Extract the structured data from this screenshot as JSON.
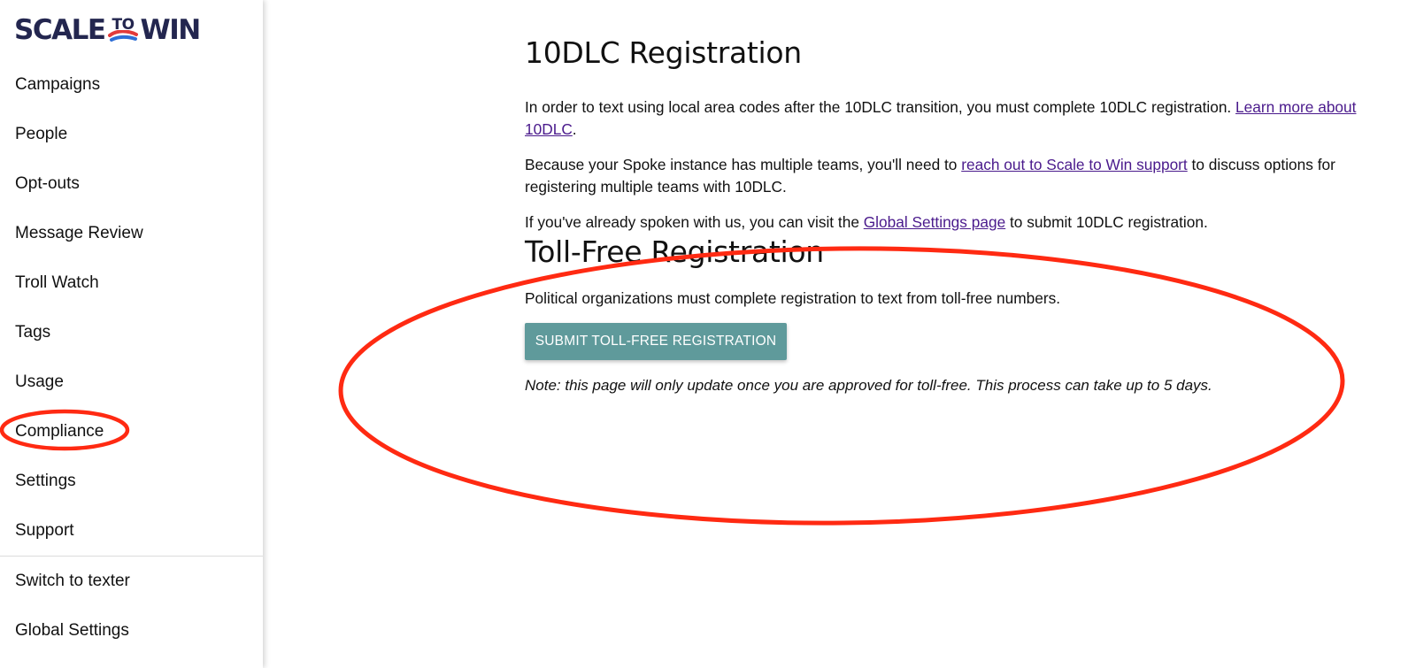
{
  "brand": {
    "logo_left": "SCALE",
    "logo_to": "TO",
    "logo_right": "WIN",
    "logo_colors": [
      "#23264f",
      "#e23a3a",
      "#2f6fd6"
    ]
  },
  "sidebar": {
    "items": [
      {
        "label": "Campaigns"
      },
      {
        "label": "People"
      },
      {
        "label": "Opt-outs"
      },
      {
        "label": "Message Review"
      },
      {
        "label": "Troll Watch"
      },
      {
        "label": "Tags"
      },
      {
        "label": "Usage"
      },
      {
        "label": "Compliance"
      },
      {
        "label": "Settings"
      },
      {
        "label": "Support"
      }
    ],
    "footer_items": [
      {
        "label": "Switch to texter"
      },
      {
        "label": "Global Settings"
      }
    ]
  },
  "main": {
    "dlc": {
      "title": "10DLC Registration",
      "p1_text": "In order to text using local area codes after the 10DLC transition, you must complete 10DLC registration. ",
      "p1_link": "Learn more about 10DLC",
      "p1_end": ".",
      "p2_text": "Because your Spoke instance has multiple teams, you'll need to ",
      "p2_link": "reach out to Scale to Win support",
      "p2_end": " to discuss options for registering multiple teams with 10DLC.",
      "p3_text": "If you've already spoken with us, you can visit the ",
      "p3_link": "Global Settings page",
      "p3_end": " to submit 10DLC registration."
    },
    "tollfree": {
      "title": "Toll-Free Registration",
      "description": "Political organizations must complete registration to text from toll-free numbers.",
      "button_label": "SUBMIT TOLL-FREE REGISTRATION",
      "note": "Note: this page will only update once you are approved for toll-free. This process can take up to 5 days."
    }
  },
  "colors": {
    "button_bg": "#5f9a9b",
    "link": "#4a1a8c",
    "annotation_red": "#ff2a12"
  }
}
